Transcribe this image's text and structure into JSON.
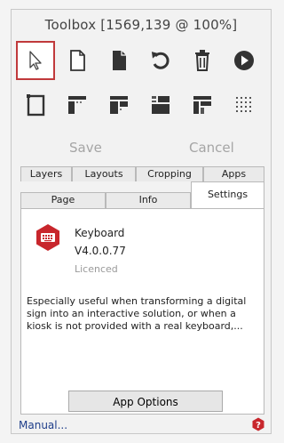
{
  "window": {
    "title": "Toolbox [1569,139 @ 100%]"
  },
  "toolbar": {
    "row1": [
      {
        "icon": "pointer-icon",
        "selected": true
      },
      {
        "icon": "new-page-icon"
      },
      {
        "icon": "copy-page-icon"
      },
      {
        "icon": "undo-icon"
      },
      {
        "icon": "delete-icon"
      },
      {
        "icon": "play-icon"
      }
    ],
    "row2": [
      {
        "icon": "page-frame-icon"
      },
      {
        "icon": "layout-grid-1-icon"
      },
      {
        "icon": "layout-grid-2-icon"
      },
      {
        "icon": "layout-grid-3-icon"
      },
      {
        "icon": "layout-grid-4-icon"
      },
      {
        "icon": "layout-dots-icon"
      }
    ]
  },
  "actions": {
    "save_label": "Save",
    "cancel_label": "Cancel"
  },
  "tabs": {
    "row1": [
      "Layers",
      "Layouts",
      "Cropping",
      "Apps"
    ],
    "row2": [
      "Page",
      "Info",
      "Settings"
    ],
    "active": "Settings"
  },
  "app": {
    "name": "Keyboard",
    "version": "V4.0.0.77",
    "license": "Licenced",
    "description": "Especially useful when transforming a digital sign into an interactive solution, or when a kiosk is not provided with a real keyboard,...",
    "options_button": "App Options",
    "icon": "keyboard-icon"
  },
  "footer": {
    "manual_link": "Manual...",
    "help_icon": "help-icon"
  },
  "colors": {
    "selection_border": "#c0393b",
    "app_icon_bg": "#c8262c",
    "link": "#1f3e8a",
    "help": "#c8262c"
  }
}
